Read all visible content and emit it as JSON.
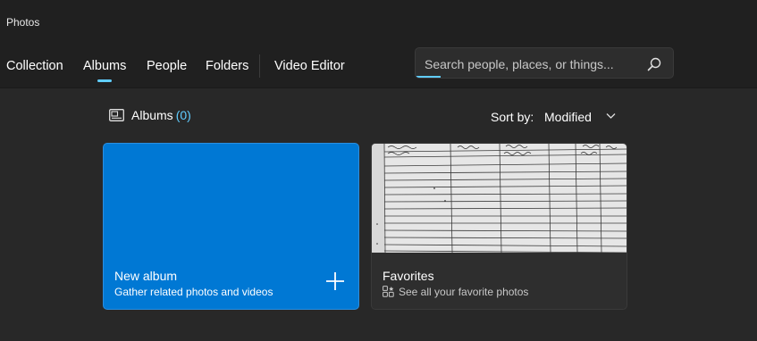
{
  "app": {
    "title": "Photos"
  },
  "nav": {
    "items": [
      {
        "label": "Collection"
      },
      {
        "label": "Albums"
      },
      {
        "label": "People"
      },
      {
        "label": "Folders"
      },
      {
        "label": "Video Editor"
      }
    ],
    "active": "Albums"
  },
  "search": {
    "placeholder": "Search people, places, or things..."
  },
  "albums_header": {
    "label": "Albums",
    "count": "(0)"
  },
  "sort": {
    "label": "Sort by:",
    "value": "Modified"
  },
  "cards": {
    "new_album": {
      "title": "New album",
      "subtitle": "Gather related photos and videos"
    },
    "favorites": {
      "title": "Favorites",
      "subtitle": "See all your favorite photos"
    }
  },
  "colors": {
    "accent": "#60cdff",
    "tile_blue": "#0078d4",
    "background": "#282828"
  },
  "icons": [
    "search-icon",
    "albums-icon",
    "chevron-down-icon",
    "plus-icon",
    "favorites-grid-icon"
  ]
}
